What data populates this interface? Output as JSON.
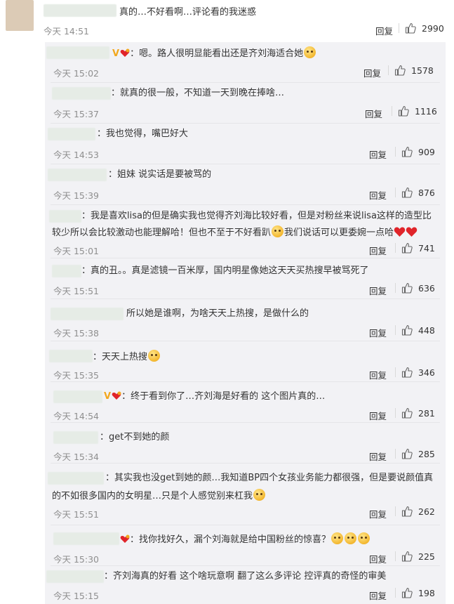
{
  "main_comment": {
    "text": "真的…不好看啊…评论看的我迷惑",
    "time": "今天 14:51",
    "reply_label": "回复",
    "likes": "2990"
  },
  "replies": [
    {
      "text": "：嗯。路人很明显能看出还是齐刘海适合她",
      "time": "今天 15:02",
      "reply_label": "回复",
      "likes": "1578",
      "emoji_end": "laugh-cry"
    },
    {
      "text": "：就真的很一般，不知道一天到晚在捧啥…",
      "time": "今天 15:37",
      "reply_label": "回复",
      "likes": "1116"
    },
    {
      "text": "：我也觉得，嘴巴好大",
      "time": "今天 14:53",
      "reply_label": "回复",
      "likes": "909"
    },
    {
      "text": "：姐妹 说实话是要被骂的",
      "time": "今天 15:39",
      "reply_label": "回复",
      "likes": "876"
    },
    {
      "text_line1": "：我是喜欢lisa的但是确实我也觉得齐刘海比较好看，但是对粉丝来说lisa这样的造型比",
      "text_line2a": "较少所以会比较激动也能理解哈！但也不至于不好看趴",
      "text_line2b": "我们说话可以更委婉一点哈",
      "time": "今天 15:01",
      "reply_label": "回复",
      "likes": "741"
    },
    {
      "text": "：真的丑。。真是滤镜一百米厚，国内明星像她这天天买热搜早被骂死了",
      "time": "今天 15:51",
      "reply_label": "回复",
      "likes": "636"
    },
    {
      "text": "所以她是谁啊，为啥天天上热搜，是做什么的",
      "time": "今天 15:38",
      "reply_label": "回复",
      "likes": "448"
    },
    {
      "text": "：天天上热搜",
      "time": "今天 15:35",
      "reply_label": "回复",
      "likes": "346"
    },
    {
      "text": "：终于看到你了…齐刘海是好看的 这个图片真的…",
      "time": "今天 14:54",
      "reply_label": "回复",
      "likes": "281"
    },
    {
      "text": "：get不到她的颜",
      "time": "今天 15:34",
      "reply_label": "回复",
      "likes": "285"
    },
    {
      "text_line1": "：其实我也没get到她的颜…我知道BP四个女孩业务能力都很强，但是要说颜值真",
      "text_line2a": "的不如很多国内的女明星…只是个人感觉别来杠我",
      "time": "今天 15:51",
      "reply_label": "回复",
      "likes": "262"
    },
    {
      "text": "：找你找好久，漏个刘海就是给中国粉丝的惊喜？",
      "time": "今天 15:30",
      "reply_label": "回复",
      "likes": "225"
    },
    {
      "text": "：齐刘海真的好看 这个啥玩意啊 翻了这么多评论 控评真的奇怪的审美",
      "time": "今天 15:15",
      "reply_label": "回复",
      "likes": "198"
    }
  ],
  "colors": {
    "badge_gold": "#f2a81e",
    "heart_red": "#e0242a",
    "reply_bg": "#f2f2f5"
  }
}
